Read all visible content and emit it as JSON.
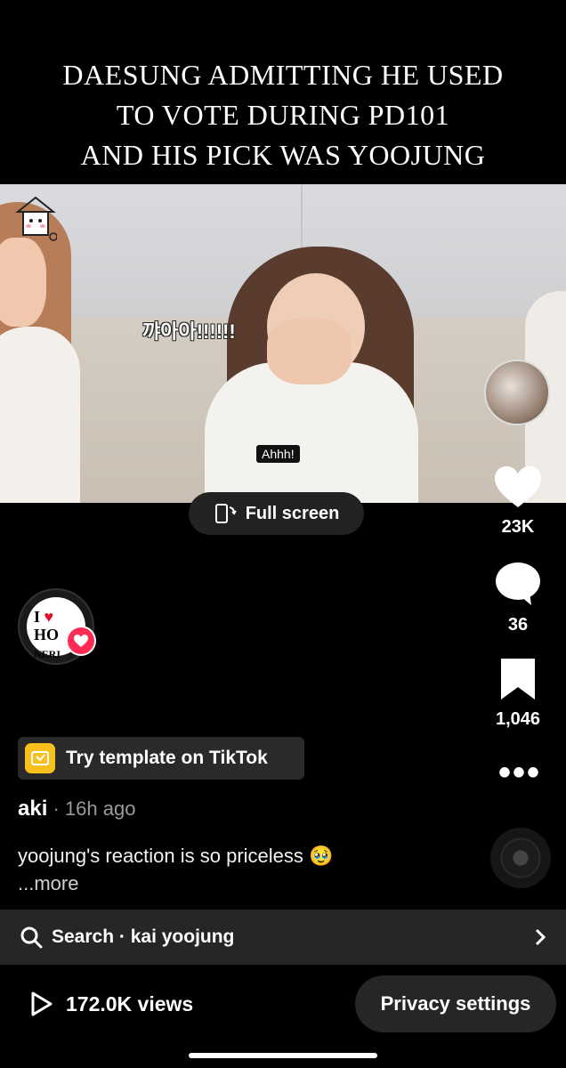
{
  "caption": "DAESUNG ADMITTING HE USED\nTO VOTE DURING PD101\nAND HIS PICK WAS YOOJUNG",
  "video": {
    "subtitle_korean": "꺄아아!!!!!!",
    "subtitle_english": "Ahhh!",
    "fullscreen_label": "Full screen"
  },
  "rail": {
    "like_count": "23K",
    "comment_count": "36",
    "bookmark_count": "1,046"
  },
  "creator_badge": {
    "line1": "I",
    "line2": "HO",
    "line3": "NERI"
  },
  "template_pill": "Try template on TikTok",
  "post": {
    "author": "aki",
    "time": " · 16h ago",
    "description": "yoojung's reaction is so priceless 🥹",
    "more": "...more"
  },
  "search": {
    "label": "Search · kai yoojung"
  },
  "footer": {
    "views": "172.0K views",
    "privacy_button": "Privacy settings"
  },
  "colors": {
    "like_red": "#fe2c55",
    "template_yellow": "#f7c01c"
  }
}
